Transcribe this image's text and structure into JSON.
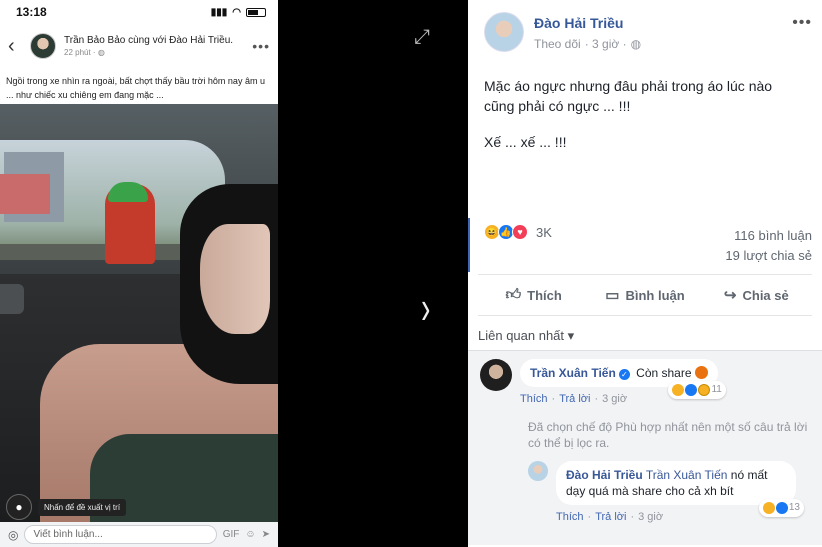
{
  "phone": {
    "time": "13:18",
    "post_author_line": "Trần Bảo Bảo cùng với Đào Hải Triều.",
    "post_time": "22 phút · ",
    "caption": "Ngồi trong xe nhìn ra ngoài, bất chợt thấy bầu trời hôm nay âm u ... như chiếc xu chiêng em đang mặc ...",
    "location_tip": "Nhấn để đề xuất vị trí",
    "comment_placeholder": "Viết bình luận...",
    "gif_label": "GIF"
  },
  "post": {
    "author": "Đào Hải Triều",
    "follow": "Theo dõi",
    "time": "· 3 giờ ·",
    "body_line1": "Mặc áo ngực nhưng đâu phải trong áo lúc nào cũng phải có ngực ... !!!",
    "body_line2": "Xế ... xế ... !!!",
    "reaction_count": "3K",
    "comment_count": "116 bình luận",
    "share_count": "19 lượt chia sẻ"
  },
  "actions": {
    "like": "Thích",
    "comment": "Bình luận",
    "share": "Chia sẻ"
  },
  "sort_label": "Liên quan nhất ▾",
  "comments": {
    "c1": {
      "name": "Trần Xuân Tiến",
      "text": "Còn share",
      "react_count": "11",
      "like": "Thích",
      "reply": "Trả lời",
      "time": "3 giờ"
    },
    "notice": "Đã chọn chế độ Phù hợp nhất nên một số câu trả lời có thể bị lọc ra.",
    "r1": {
      "name": "Đào Hải Triều",
      "mention": "Trần Xuân Tiến",
      "text": "nó mất dạy quá mà share cho cả xh bít",
      "react_count": "13",
      "like": "Thích",
      "reply": "Trả lời",
      "time": "3 giờ"
    }
  },
  "icons": {
    "expand": "expand-icon",
    "next": "chevron-right-icon",
    "globe": "globe-icon",
    "more": "more-icon"
  },
  "colors": {
    "link_blue": "#365899",
    "action_gray": "#606770",
    "like_blue": "#1877f2",
    "haha_yellow": "#f7b125",
    "love_red": "#f33e58"
  }
}
